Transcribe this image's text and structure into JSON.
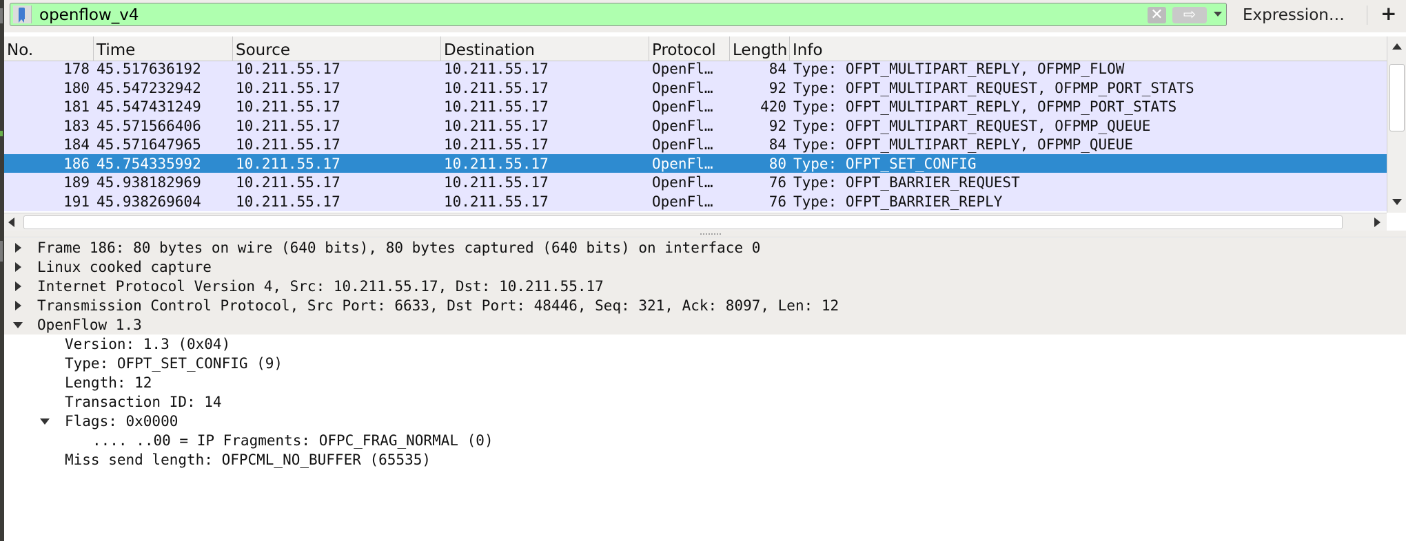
{
  "filter": {
    "value": "openflow_v4",
    "clear_icon": "clear-icon",
    "apply_icon": "apply-arrow-icon",
    "history_icon": "chevron-down-icon",
    "expression_label": "Expression…",
    "add_label": "+"
  },
  "packet_list": {
    "columns": {
      "no": "No.",
      "time": "Time",
      "source": "Source",
      "destination": "Destination",
      "protocol": "Protocol",
      "length": "Length",
      "info": "Info"
    },
    "rows": [
      {
        "no": "178",
        "time": "45.517636192",
        "source": "10.211.55.17",
        "destination": "10.211.55.17",
        "protocol": "OpenFl…",
        "length": "84",
        "info": "Type: OFPT_MULTIPART_REPLY, OFPMP_FLOW"
      },
      {
        "no": "180",
        "time": "45.547232942",
        "source": "10.211.55.17",
        "destination": "10.211.55.17",
        "protocol": "OpenFl…",
        "length": "92",
        "info": "Type: OFPT_MULTIPART_REQUEST, OFPMP_PORT_STATS"
      },
      {
        "no": "181",
        "time": "45.547431249",
        "source": "10.211.55.17",
        "destination": "10.211.55.17",
        "protocol": "OpenFl…",
        "length": "420",
        "info": "Type: OFPT_MULTIPART_REPLY, OFPMP_PORT_STATS"
      },
      {
        "no": "183",
        "time": "45.571566406",
        "source": "10.211.55.17",
        "destination": "10.211.55.17",
        "protocol": "OpenFl…",
        "length": "92",
        "info": "Type: OFPT_MULTIPART_REQUEST, OFPMP_QUEUE"
      },
      {
        "no": "184",
        "time": "45.571647965",
        "source": "10.211.55.17",
        "destination": "10.211.55.17",
        "protocol": "OpenFl…",
        "length": "84",
        "info": "Type: OFPT_MULTIPART_REPLY, OFPMP_QUEUE"
      },
      {
        "no": "186",
        "time": "45.754335992",
        "source": "10.211.55.17",
        "destination": "10.211.55.17",
        "protocol": "OpenFl…",
        "length": "80",
        "info": "Type: OFPT_SET_CONFIG",
        "selected": true
      },
      {
        "no": "189",
        "time": "45.938182969",
        "source": "10.211.55.17",
        "destination": "10.211.55.17",
        "protocol": "OpenFl…",
        "length": "76",
        "info": "Type: OFPT_BARRIER_REQUEST"
      },
      {
        "no": "191",
        "time": "45.938269604",
        "source": "10.211.55.17",
        "destination": "10.211.55.17",
        "protocol": "OpenFl…",
        "length": "76",
        "info": "Type: OFPT_BARRIER_REPLY"
      }
    ],
    "colors": {
      "row_bg": "#e7e6ff",
      "selected_bg": "#2e8bd0",
      "filter_valid_bg": "#afffaf"
    }
  },
  "details": {
    "frame": "Frame 186: 80 bytes on wire (640 bits), 80 bytes captured (640 bits) on interface 0",
    "linux_cooked": "Linux cooked capture",
    "ipv4": "Internet Protocol Version 4, Src: 10.211.55.17, Dst: 10.211.55.17",
    "tcp": "Transmission Control Protocol, Src Port: 6633, Dst Port: 48446, Seq: 321, Ack: 8097, Len: 12",
    "openflow": "OpenFlow 1.3",
    "version": "Version: 1.3 (0x04)",
    "type": "Type: OFPT_SET_CONFIG (9)",
    "length": "Length: 12",
    "xid": "Transaction ID: 14",
    "flags": "Flags: 0x0000",
    "frag": ".... ..00 = IP Fragments: OFPC_FRAG_NORMAL (0)",
    "miss_send": "Miss send length: OFPCML_NO_BUFFER (65535)"
  }
}
